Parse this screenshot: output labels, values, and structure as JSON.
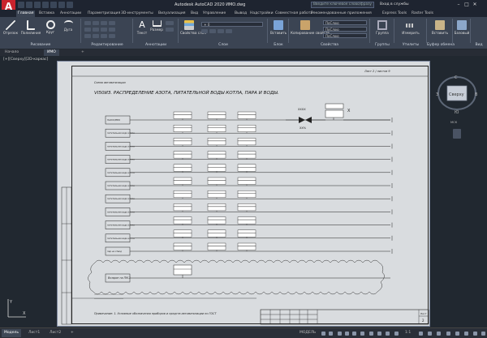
{
  "app": {
    "title": "Autodesk AutoCAD 2020   ИМО.dwg",
    "logo": "A",
    "search_placeholder": "Введите ключевое слово/фразу",
    "signin": "Вход в службы"
  },
  "ribbon_tabs": [
    "Главная",
    "Вставка",
    "Аннотации",
    "Параметризация",
    "3D-инструменты",
    "Визуализация",
    "Вид",
    "Управление",
    "Вывод",
    "Надстройки",
    "Совместная работа",
    "Рекомендованные приложения",
    "Express Tools",
    "Raster Tools"
  ],
  "ribbon": {
    "draw": {
      "label": "Рисование",
      "tools": [
        "Отрезок",
        "Полилиния",
        "Круг",
        "Дуга"
      ]
    },
    "modify": {
      "label": "Редактирование"
    },
    "annotation": {
      "label": "Аннотации",
      "tools": [
        "Текст",
        "Размер"
      ]
    },
    "layers": {
      "label": "Слои",
      "tools": [
        "Свойства слоя"
      ]
    },
    "block": {
      "label": "Блок",
      "tools": [
        "Вставить"
      ]
    },
    "properties": {
      "label": "Свойства",
      "tools": [
        "Копирование свойств"
      ],
      "dropdowns": [
        "ПоСлою",
        "ПоСлою",
        "ПоСлою"
      ]
    },
    "groups": {
      "label": "Группы",
      "tools": [
        "Группа"
      ]
    },
    "utilities": {
      "label": "Утилиты",
      "tools": [
        "Измерить"
      ]
    },
    "clipboard": {
      "label": "Буфер обмена",
      "tools": [
        "Вставить"
      ]
    },
    "base": {
      "label": "",
      "tools": [
        "Базовый"
      ]
    },
    "view": {
      "label": "Вид"
    }
  },
  "doc_tabs": [
    "Начало",
    "ИМО"
  ],
  "viewport_label": "[+][Сверху][2D-каркас]",
  "viewcube": {
    "top": "Сверху",
    "north": "С",
    "south": "Ю",
    "west": "З",
    "east": "В",
    "wcs": "МСК"
  },
  "drawing": {
    "title": "VI50ИЗ. РАСПРЕДЕЛЕНИЕ АЗОТА, ПИТАТЕЛЬНОЙ ВОДЫ КОТЛА, ПАРА И ВОДЫ.",
    "header_note": "Лист 2 / листов 9",
    "left_note": "Схема автоматизации",
    "rows": [
      "НАСОС/ВВО",
      "питательная вода котла",
      "питательная вода котла",
      "питательная вода котла",
      "питательная вода котла",
      "питательная вода котла",
      "питательная вода котла",
      "питательная вода котла",
      "питательная вода котла",
      "питательная вода котла",
      "пар на отвод"
    ],
    "cloud_label": "Возврат на ПМ-1",
    "valve_label": "ХХХХ",
    "valve_sub": "ХХ%",
    "footnote": "Примечание: 1. Условные обозначения приборов и средств автоматизации по ГОСТ",
    "stamp_label": "Лист",
    "stamp_sheet": "2"
  },
  "status": {
    "tabs": [
      "Модель",
      "Лист1",
      "Лист2"
    ],
    "model_btn": "МОДЕЛЬ",
    "scale": "1:1"
  }
}
